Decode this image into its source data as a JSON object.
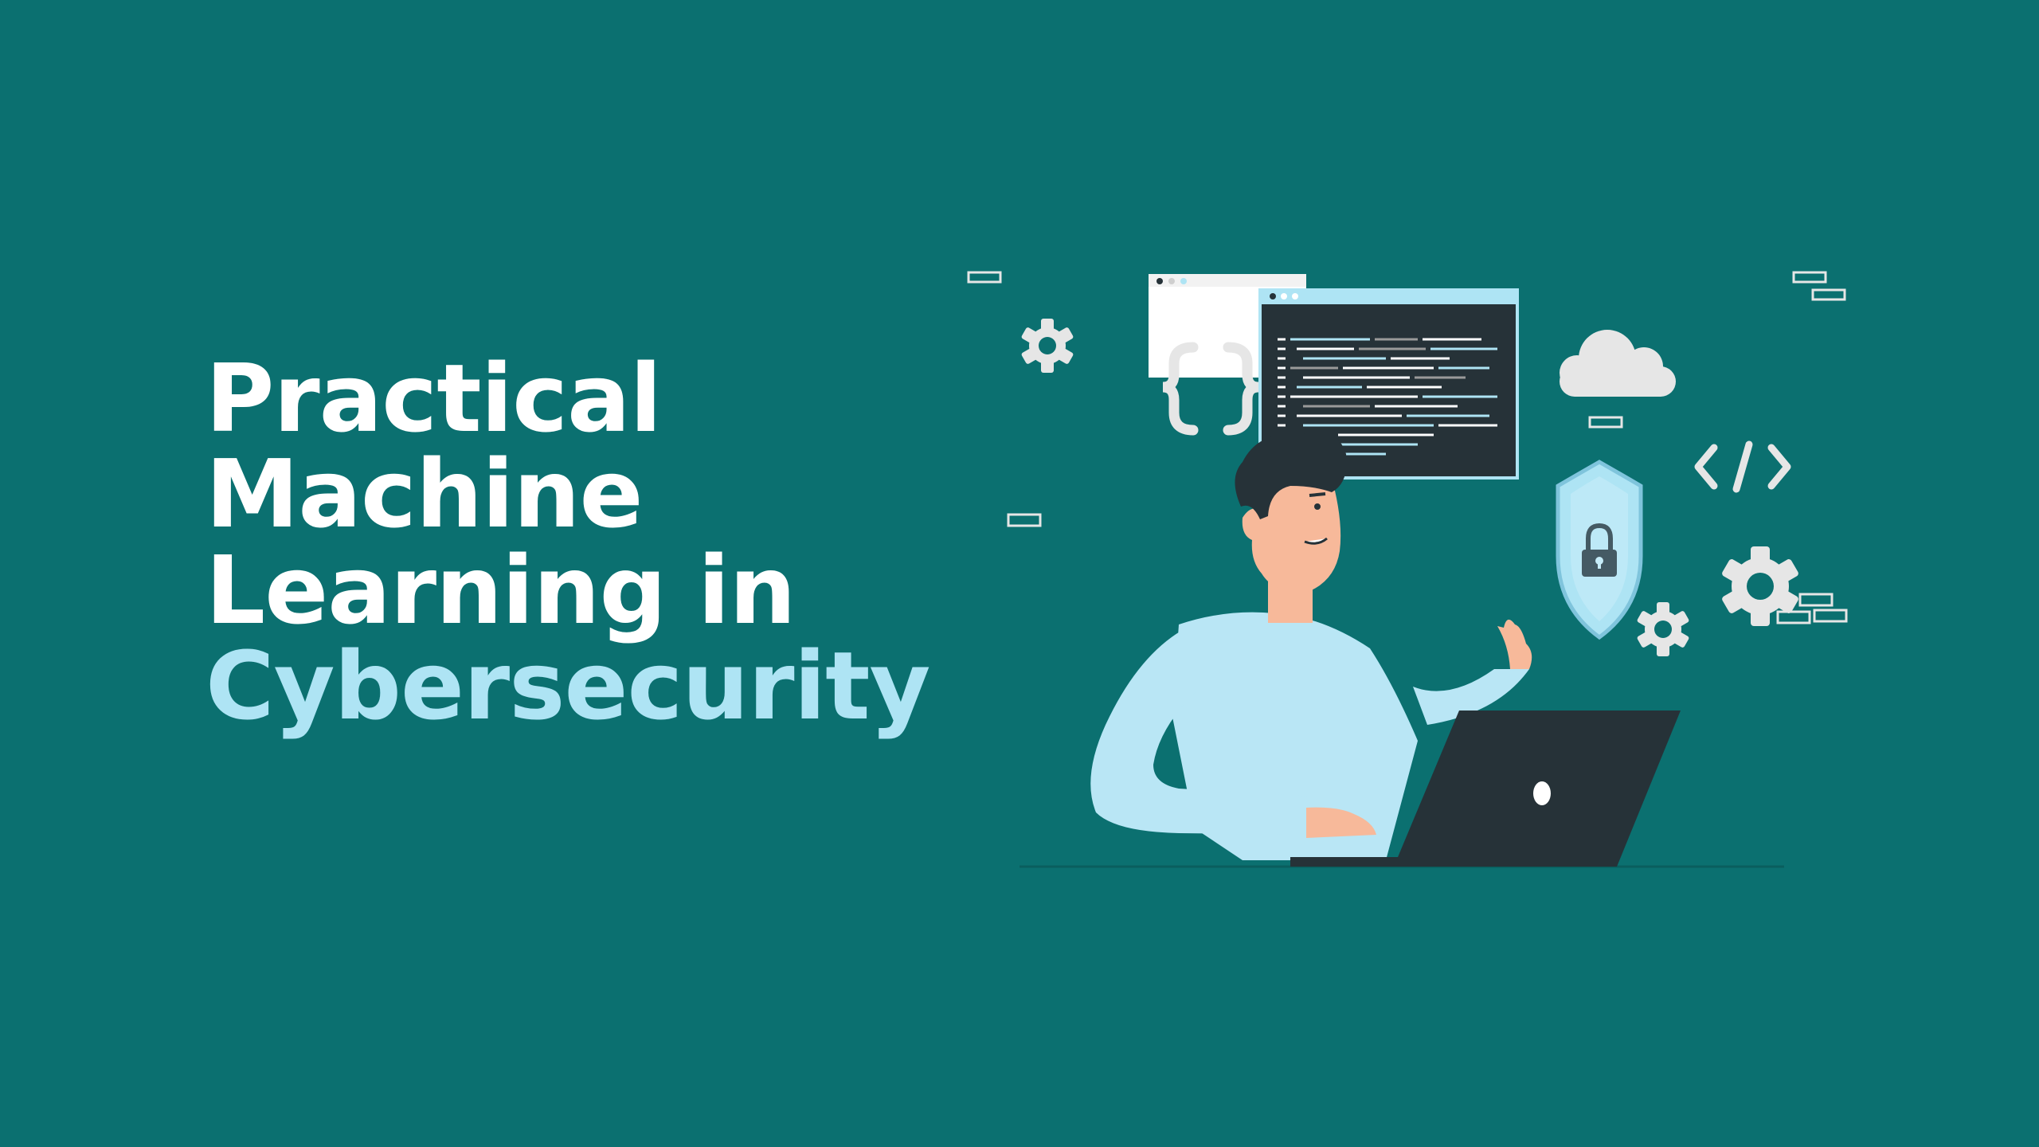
{
  "banner": {
    "title_lines": [
      "Practical",
      "Machine",
      "Learning in"
    ],
    "title_accent": "Cybersecurity"
  },
  "illustration": {
    "icons": [
      "gear-icon",
      "curly-braces-icon",
      "code-window",
      "cloud-icon",
      "code-tag-icon",
      "shield-lock-icon",
      "laptop"
    ]
  },
  "colors": {
    "background": "#0b7070",
    "title": "#ffffff",
    "accent": "#aee4f4",
    "shirt": "#b9e6f5",
    "skin": "#f7b99a",
    "laptop": "#263238",
    "icon_gray": "#e6e6e6"
  }
}
